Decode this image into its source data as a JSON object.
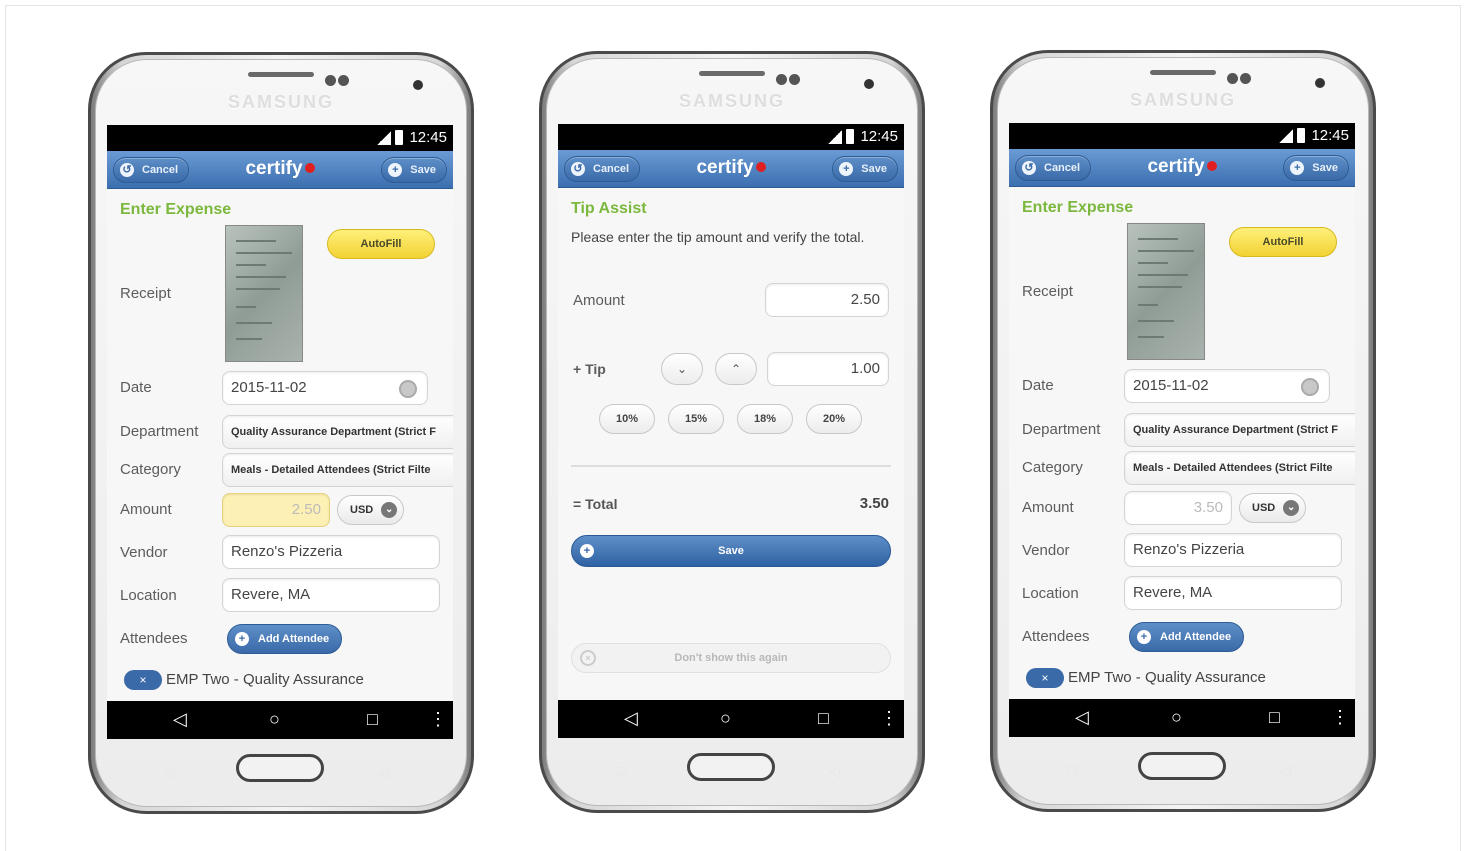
{
  "phones": [
    {
      "brand": "SAMSUNG",
      "status": {
        "time": "12:45"
      },
      "header": {
        "cancel_label": "Cancel",
        "logo": "certify",
        "save_label": "Save"
      },
      "screen": {
        "title": "Enter Expense",
        "receipt_label": "Receipt",
        "autofill_label": "AutoFill",
        "date_label": "Date",
        "date_value": "2015-11-02",
        "department_label": "Department",
        "department_value": "Quality Assurance Department (Strict F",
        "category_label": "Category",
        "category_value": "Meals - Detailed Attendees (Strict Filte",
        "amount_label": "Amount",
        "amount_value": "2.50",
        "currency": "USD",
        "vendor_label": "Vendor",
        "vendor_value": "Renzo's Pizzeria",
        "location_label": "Location",
        "location_value": "Revere, MA",
        "attendees_label": "Attendees",
        "add_attendee_label": "Add Attendee",
        "attendee_item": "EMP Two - Quality Assurance"
      }
    },
    {
      "brand": "SAMSUNG",
      "status": {
        "time": "12:45"
      },
      "header": {
        "cancel_label": "Cancel",
        "logo": "certify",
        "save_label": "Save"
      },
      "screen": {
        "title": "Tip Assist",
        "instructions": "Please enter the tip amount and verify the total.",
        "amount_label": "Amount",
        "amount_value": "2.50",
        "tip_label": "+ Tip",
        "tip_value": "1.00",
        "tip_options": [
          "10%",
          "15%",
          "18%",
          "20%"
        ],
        "total_label": "= Total",
        "total_value": "3.50",
        "save_label": "Save",
        "dont_show_label": "Don't show this again"
      }
    },
    {
      "brand": "SAMSUNG",
      "status": {
        "time": "12:45"
      },
      "header": {
        "cancel_label": "Cancel",
        "logo": "certify",
        "save_label": "Save"
      },
      "screen": {
        "title": "Enter Expense",
        "receipt_label": "Receipt",
        "autofill_label": "AutoFill",
        "date_label": "Date",
        "date_value": "2015-11-02",
        "department_label": "Department",
        "department_value": "Quality Assurance Department (Strict F",
        "category_label": "Category",
        "category_value": "Meals - Detailed Attendees (Strict Filte",
        "amount_label": "Amount",
        "amount_value": "3.50",
        "currency": "USD",
        "vendor_label": "Vendor",
        "vendor_value": "Renzo's Pizzeria",
        "location_label": "Location",
        "location_value": "Revere, MA",
        "attendees_label": "Attendees",
        "add_attendee_label": "Add Attendee",
        "attendee_item": "EMP Two - Quality Assurance"
      }
    }
  ],
  "icons": {
    "back": "◁",
    "home": "○",
    "recents": "□",
    "menu": "⋮",
    "cancel": "↺",
    "plus": "+",
    "chevron_down": "⌄",
    "chevron_up": "⌃",
    "close": "×"
  },
  "colors": {
    "accent_green": "#7cb83e",
    "header_blue": "#3c6fb0",
    "autofill_yellow": "#f2d233",
    "amount_highlight": "#fdf0b4",
    "logo_red": "#e02020"
  }
}
